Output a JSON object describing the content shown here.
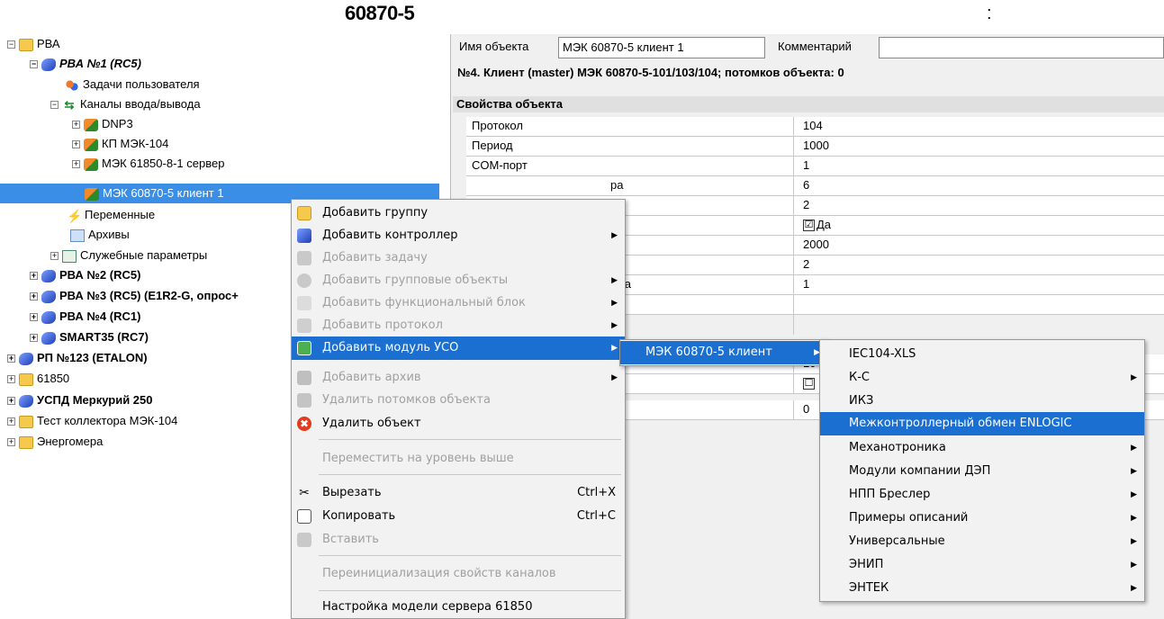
{
  "page": {
    "title": "60870-5",
    "title_suffix": ":"
  },
  "tree": {
    "nodes": [
      {
        "label": "РВА",
        "icon": "folder-icon",
        "exp": "−"
      },
      {
        "label": "РВА №1 (RC5)",
        "icon": "controller-icon",
        "exp": "−"
      },
      {
        "label": "Задачи пользователя",
        "icon": "users-icon"
      },
      {
        "label": "Каналы ввода/вывода",
        "icon": "io-channels-icon",
        "exp": "−"
      },
      {
        "label": "DNP3",
        "icon": "protocol-icon",
        "exp": "+"
      },
      {
        "label": "КП МЭК-104",
        "icon": "protocol-icon",
        "exp": "+"
      },
      {
        "label": "МЭК 61850-8-1 сервер",
        "icon": "protocol-icon",
        "exp": "+"
      },
      {
        "label": "МЭК 60870-5 клиент 1",
        "icon": "protocol-icon"
      },
      {
        "label": "Переменные",
        "icon": "lightning-icon"
      },
      {
        "label": "Архивы",
        "icon": "archive-icon"
      },
      {
        "label": "Служебные параметры",
        "icon": "service-icon",
        "exp": "+"
      },
      {
        "label": "РВА №2 (RC5)",
        "icon": "controller-icon",
        "exp": "+"
      },
      {
        "label": "РВА №3 (RC5) (E1R2-G, опрос+",
        "icon": "controller-icon",
        "exp": "+"
      },
      {
        "label": "РВА №4 (RC1)",
        "icon": "controller-icon",
        "exp": "+"
      },
      {
        "label": "SMART35 (RC7)",
        "icon": "controller-icon",
        "exp": "+"
      },
      {
        "label": "РП №123 (ETALON)",
        "icon": "controller-icon",
        "exp": "+"
      },
      {
        "label": "61850",
        "icon": "folder-icon",
        "exp": "+"
      },
      {
        "label": "УСПД Меркурий 250",
        "icon": "controller-icon",
        "exp": "+"
      },
      {
        "label": "Тест коллектора МЭК-104",
        "icon": "folder-icon",
        "exp": "+"
      },
      {
        "label": "Энергомера",
        "icon": "folder-icon",
        "exp": "+"
      }
    ]
  },
  "object": {
    "name_label": "Имя объекта",
    "name_value": "МЭК 60870-5 клиент 1",
    "comment_label": "Комментарий",
    "comment_value": "",
    "info": "№4. Клиент (master) МЭК 60870-5-101/103/104; потомков объекта: 0"
  },
  "properties": {
    "header": "Свойства объекта",
    "rows": [
      {
        "key": "Протокол",
        "value": "104"
      },
      {
        "key": "Период",
        "value": "1000"
      },
      {
        "key": "COM-порт",
        "value": "1"
      },
      {
        "key": "ра",
        "value": "6"
      },
      {
        "key": "",
        "value": "2"
      },
      {
        "key": "",
        "value": "Да",
        "check": "☑"
      },
      {
        "key": "",
        "value": "2000"
      },
      {
        "key": "",
        "value": "2"
      },
      {
        "key": "та",
        "value": "1"
      },
      {
        "key": "",
        "value": ""
      },
      {
        "key": "",
        "value": "10"
      },
      {
        "key": "",
        "value": "",
        "check": "☐"
      },
      {
        "key": "",
        "value": "0"
      }
    ]
  },
  "context_menu": {
    "items": [
      {
        "label": "Добавить группу",
        "icon": "folder-icon"
      },
      {
        "label": "Добавить контроллер",
        "icon": "controller-icon",
        "submenu": true
      },
      {
        "label": "Добавить задачу",
        "icon": "task-icon",
        "disabled": true
      },
      {
        "label": "Добавить групповые объекты",
        "icon": "group-objects-icon",
        "disabled": true,
        "submenu": true
      },
      {
        "label": "Добавить функциональный блок",
        "icon": "function-block-icon",
        "disabled": true,
        "submenu": true
      },
      {
        "label": "Добавить протокол",
        "icon": "protocol-icon",
        "disabled": true,
        "submenu": true
      },
      {
        "label": "Добавить модуль УСО",
        "icon": "io-module-icon",
        "submenu": true,
        "highlight": true
      },
      {
        "label": "Добавить архив",
        "icon": "archive-icon",
        "disabled": true,
        "submenu": true
      },
      {
        "label": "Удалить потомков объекта",
        "icon": "delete-children-icon",
        "disabled": true
      },
      {
        "label": "Удалить объект",
        "icon": "delete-icon"
      },
      {
        "label": "Переместить на уровень выше",
        "disabled": true
      },
      {
        "label": "Вырезать",
        "icon": "cut-icon",
        "shortcut": "Ctrl+X"
      },
      {
        "label": "Копировать",
        "icon": "copy-icon",
        "shortcut": "Ctrl+C"
      },
      {
        "label": "Вставить",
        "icon": "paste-icon",
        "disabled": true
      },
      {
        "label": "Переинициализация свойств каналов",
        "disabled": true
      },
      {
        "label": "Настройка модели сервера 61850"
      }
    ]
  },
  "submenu1": {
    "items": [
      {
        "label": "МЭК 60870-5 клиент",
        "submenu": true,
        "highlight": true
      }
    ]
  },
  "submenu2": {
    "items": [
      {
        "label": "IEC104-XLS"
      },
      {
        "label": "К-С",
        "submenu": true
      },
      {
        "label": "ИКЗ"
      },
      {
        "label": "Межконтроллерный обмен ENLOGIC",
        "highlight": true
      },
      {
        "label": "Механотроника",
        "submenu": true
      },
      {
        "label": "Модули компании ДЭП",
        "submenu": true
      },
      {
        "label": "НПП Бреслер",
        "submenu": true
      },
      {
        "label": "Примеры описаний",
        "submenu": true
      },
      {
        "label": "Универсальные",
        "submenu": true
      },
      {
        "label": "ЭНИП",
        "submenu": true
      },
      {
        "label": "ЭНТЕК",
        "submenu": true
      }
    ]
  },
  "colors": {
    "selection": "#3a8ee6",
    "menu_highlight": "#1a6fd1",
    "folder": "#f5c94b"
  }
}
